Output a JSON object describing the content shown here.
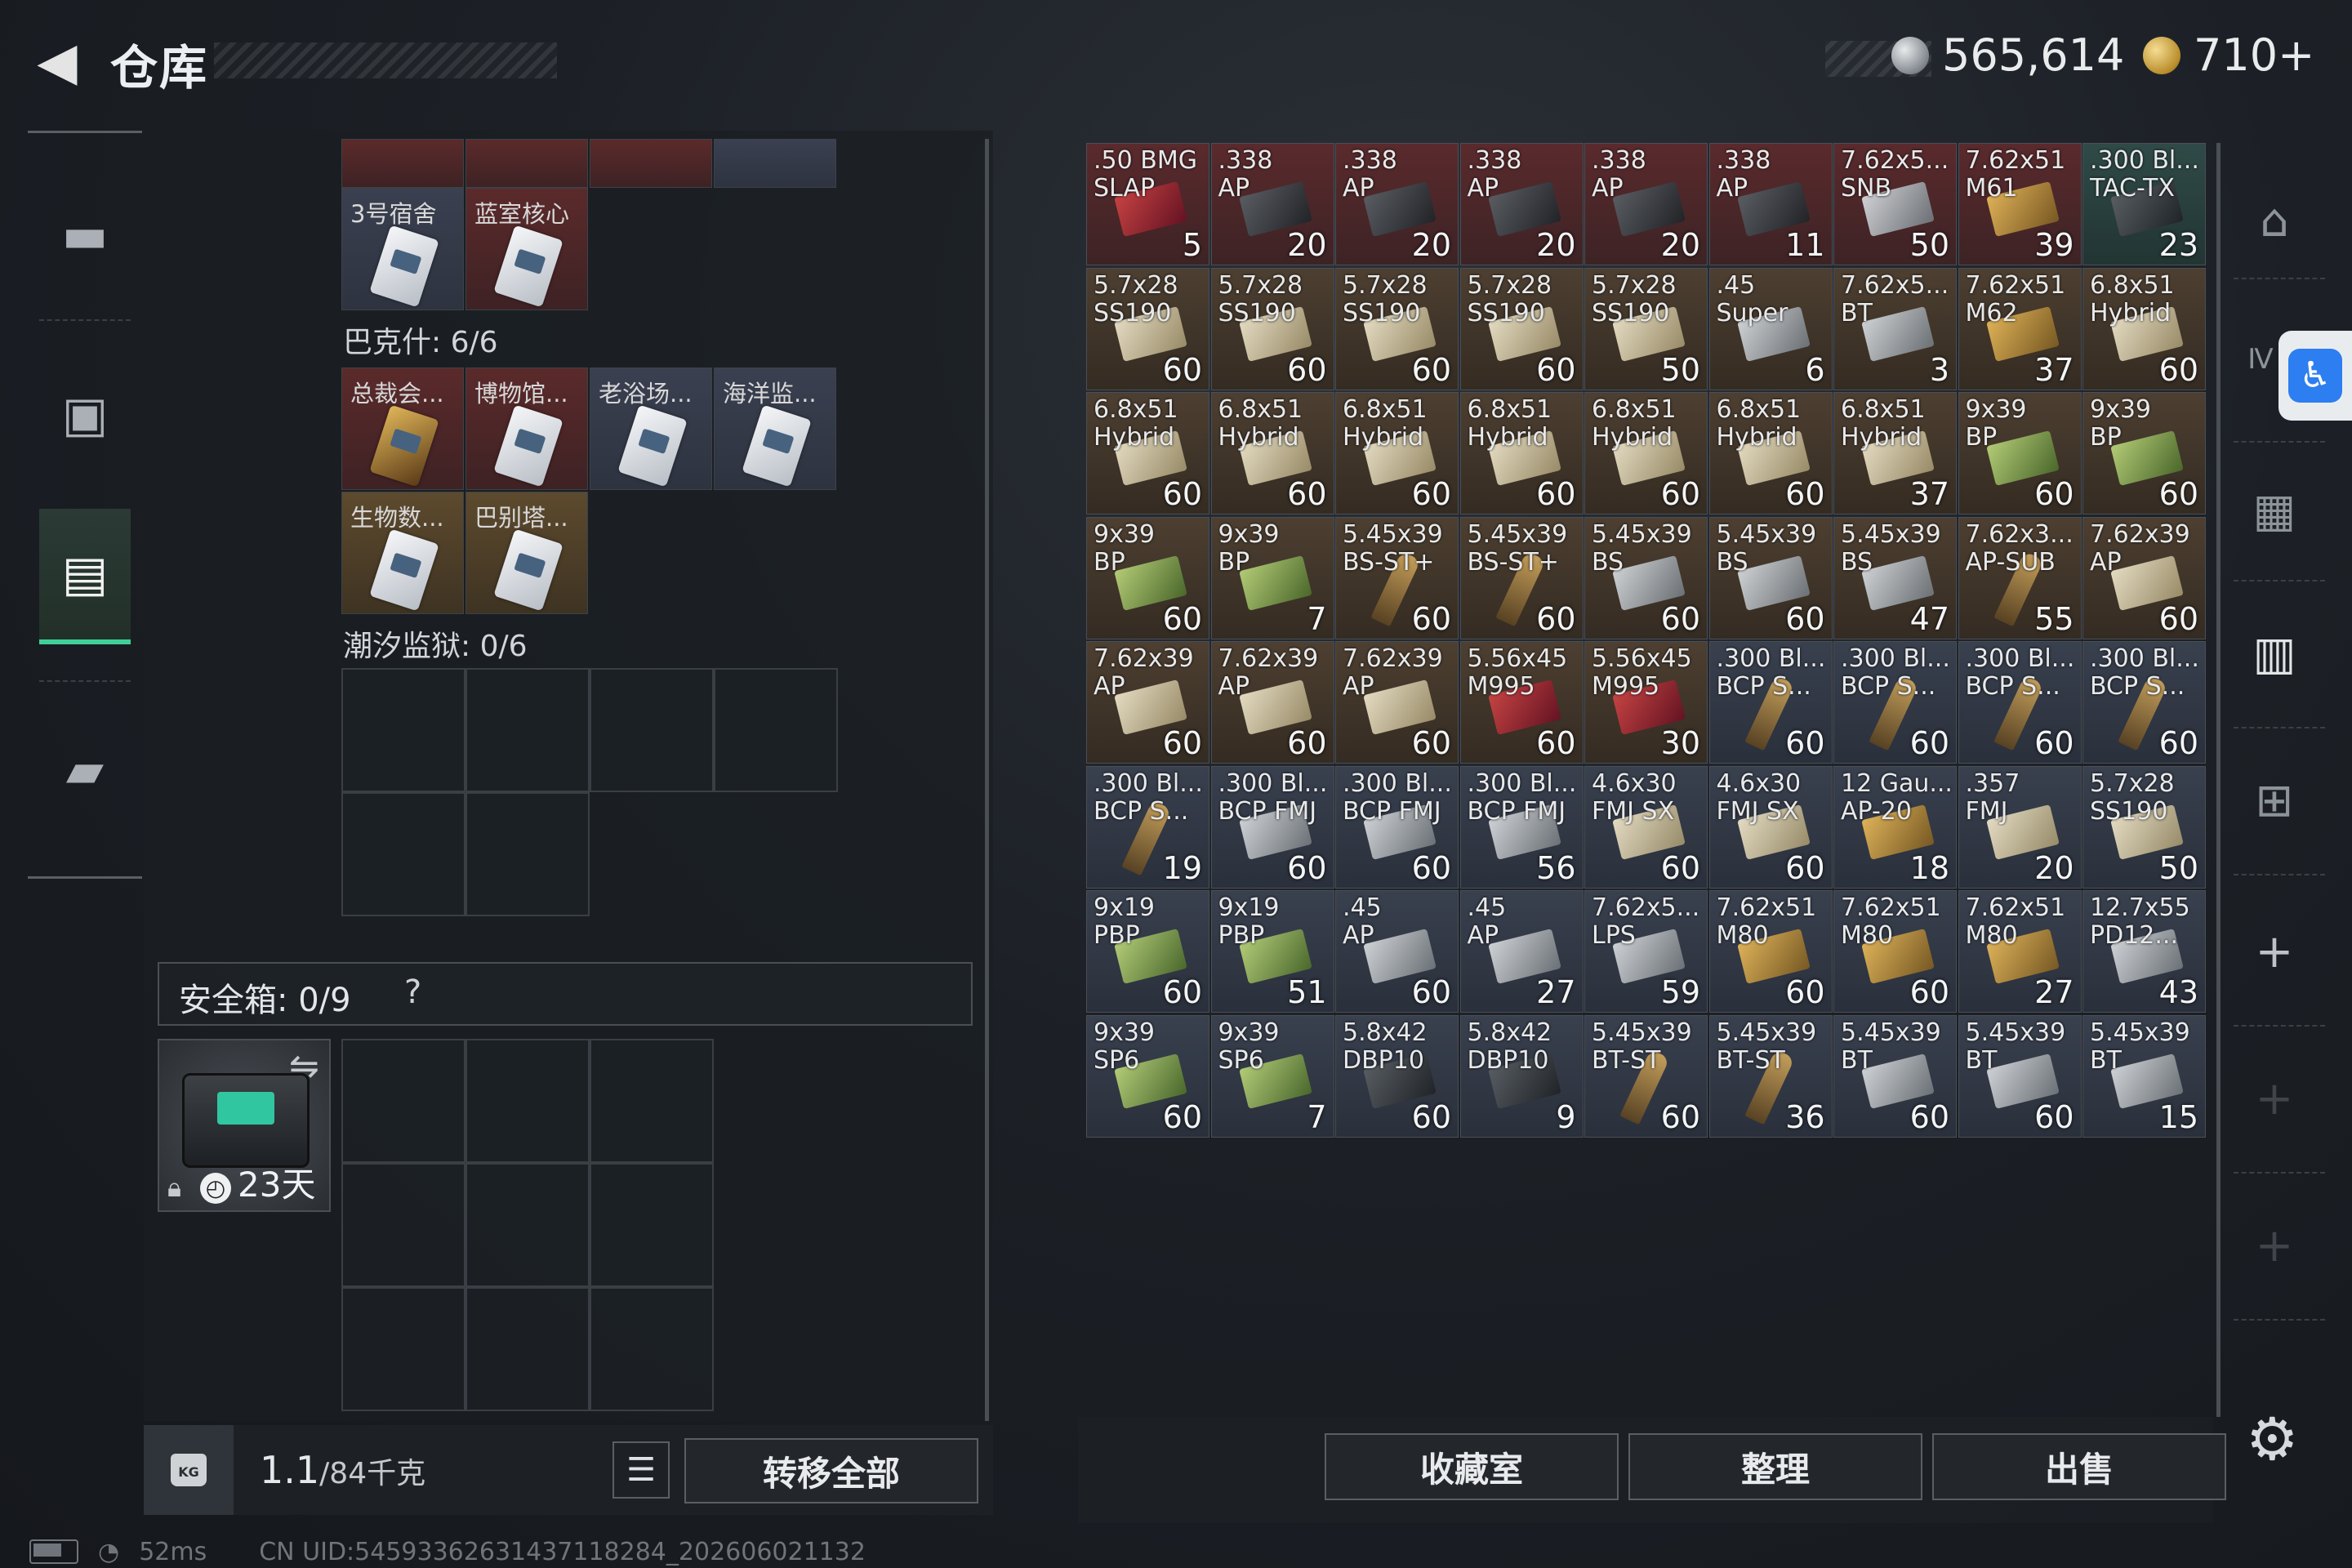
{
  "header": {
    "back_glyph": "◀",
    "title": "仓库",
    "silver_amount": "565,614",
    "gold_amount": "710+"
  },
  "sidebar": {
    "items": [
      {
        "name": "weapon",
        "icon": "pistol-icon"
      },
      {
        "name": "backpack",
        "icon": "backpack-icon"
      },
      {
        "name": "storage",
        "icon": "container-icon",
        "active": true
      },
      {
        "name": "case",
        "icon": "briefcase-icon"
      }
    ]
  },
  "keycards": {
    "top_row": [
      {
        "label": "",
        "color": "red"
      },
      {
        "label": "",
        "color": "red"
      },
      {
        "label": "",
        "color": "red"
      },
      {
        "label": "",
        "color": "blue"
      }
    ],
    "row2": [
      {
        "label": "3号宿舍",
        "color": "blue"
      },
      {
        "label": "蓝室核心",
        "color": "red"
      }
    ],
    "group1_label": "巴克什: 6/6",
    "group1_row1": [
      {
        "label": "总裁会...",
        "color": "red",
        "art": "gold"
      },
      {
        "label": "博物馆...",
        "color": "red"
      },
      {
        "label": "老浴场...",
        "color": "blue"
      },
      {
        "label": "海洋监...",
        "color": "blue"
      }
    ],
    "group1_row2": [
      {
        "label": "生物数...",
        "color": "gold"
      },
      {
        "label": "巴别塔...",
        "color": "gold"
      }
    ],
    "group2_label": "潮汐监狱: 0/6"
  },
  "safe": {
    "title": "安全箱:  0/9",
    "help": "?",
    "days": "23天"
  },
  "bottom_left": {
    "weight_icon_text": "KG",
    "weight": "1.1",
    "capacity": "/84",
    "unit": "千克",
    "transfer_all": "转移全部"
  },
  "ammo": [
    [
      {
        "name": ".50 BMG\nSLAP",
        "count": "5",
        "color": "red",
        "art": "red"
      },
      {
        "name": ".338\nAP",
        "count": "20",
        "color": "red",
        "art": "dark"
      },
      {
        "name": ".338\nAP",
        "count": "20",
        "color": "red",
        "art": "dark"
      },
      {
        "name": ".338\nAP",
        "count": "20",
        "color": "red",
        "art": "dark"
      },
      {
        "name": ".338\nAP",
        "count": "20",
        "color": "red",
        "art": "dark"
      },
      {
        "name": ".338\nAP",
        "count": "11",
        "color": "red",
        "art": "dark"
      },
      {
        "name": "7.62x5...\nSNB",
        "count": "50",
        "color": "red",
        "art": "gray"
      },
      {
        "name": "7.62x51\nM61",
        "count": "39",
        "color": "red",
        "art": "gold"
      },
      {
        "name": ".300 Bl...\nTAC-TX",
        "count": "23",
        "color": "teal",
        "art": "dark"
      }
    ],
    [
      {
        "name": "5.7x28\nSS190",
        "count": "60",
        "color": "brown",
        "art": "box"
      },
      {
        "name": "5.7x28\nSS190",
        "count": "60",
        "color": "brown",
        "art": "box"
      },
      {
        "name": "5.7x28\nSS190",
        "count": "60",
        "color": "brown",
        "art": "box"
      },
      {
        "name": "5.7x28\nSS190",
        "count": "60",
        "color": "brown",
        "art": "box"
      },
      {
        "name": "5.7x28\nSS190",
        "count": "50",
        "color": "brown",
        "art": "box"
      },
      {
        "name": ".45\nSuper",
        "count": "6",
        "color": "brown",
        "art": "gray"
      },
      {
        "name": "7.62x5...\nBT",
        "count": "3",
        "color": "brown",
        "art": "gray"
      },
      {
        "name": "7.62x51\nM62",
        "count": "37",
        "color": "brown",
        "art": "gold"
      },
      {
        "name": "6.8x51\nHybrid",
        "count": "60",
        "color": "brown",
        "art": "box"
      }
    ],
    [
      {
        "name": "6.8x51\nHybrid",
        "count": "60",
        "color": "brown",
        "art": "box"
      },
      {
        "name": "6.8x51\nHybrid",
        "count": "60",
        "color": "brown",
        "art": "box"
      },
      {
        "name": "6.8x51\nHybrid",
        "count": "60",
        "color": "brown",
        "art": "box"
      },
      {
        "name": "6.8x51\nHybrid",
        "count": "60",
        "color": "brown",
        "art": "box"
      },
      {
        "name": "6.8x51\nHybrid",
        "count": "60",
        "color": "brown",
        "art": "box"
      },
      {
        "name": "6.8x51\nHybrid",
        "count": "60",
        "color": "brown",
        "art": "box"
      },
      {
        "name": "6.8x51\nHybrid",
        "count": "37",
        "color": "brown",
        "art": "box"
      },
      {
        "name": "9x39\nBP",
        "count": "60",
        "color": "brown",
        "art": "green"
      },
      {
        "name": "9x39\nBP",
        "count": "60",
        "color": "brown",
        "art": "green"
      }
    ],
    [
      {
        "name": "9x39\nBP",
        "count": "60",
        "color": "brown",
        "art": "green"
      },
      {
        "name": "9x39\nBP",
        "count": "7",
        "color": "brown",
        "art": "green"
      },
      {
        "name": "5.45x39\nBS-ST+",
        "count": "60",
        "color": "brown",
        "art": "bullet"
      },
      {
        "name": "5.45x39\nBS-ST+",
        "count": "60",
        "color": "brown",
        "art": "bullet"
      },
      {
        "name": "5.45x39\nBS",
        "count": "60",
        "color": "brown",
        "art": "gray"
      },
      {
        "name": "5.45x39\nBS",
        "count": "60",
        "color": "brown",
        "art": "gray"
      },
      {
        "name": "5.45x39\nBS",
        "count": "47",
        "color": "brown",
        "art": "gray"
      },
      {
        "name": "7.62x3...\nAP-SUB",
        "count": "55",
        "color": "brown",
        "art": "bullet"
      },
      {
        "name": "7.62x39\nAP",
        "count": "60",
        "color": "brown",
        "art": "box"
      }
    ],
    [
      {
        "name": "7.62x39\nAP",
        "count": "60",
        "color": "brown",
        "art": "box"
      },
      {
        "name": "7.62x39\nAP",
        "count": "60",
        "color": "brown",
        "art": "box"
      },
      {
        "name": "7.62x39\nAP",
        "count": "60",
        "color": "brown",
        "art": "box"
      },
      {
        "name": "5.56x45\nM995",
        "count": "60",
        "color": "brown",
        "art": "red"
      },
      {
        "name": "5.56x45\nM995",
        "count": "30",
        "color": "brown",
        "art": "red"
      },
      {
        "name": ".300 Bl...\nBCP S...",
        "count": "60",
        "color": "blue",
        "art": "bullet"
      },
      {
        "name": ".300 Bl...\nBCP S...",
        "count": "60",
        "color": "blue",
        "art": "bullet"
      },
      {
        "name": ".300 Bl...\nBCP S...",
        "count": "60",
        "color": "blue",
        "art": "bullet"
      },
      {
        "name": ".300 Bl...\nBCP S...",
        "count": "60",
        "color": "blue",
        "art": "bullet"
      }
    ],
    [
      {
        "name": ".300 Bl...\nBCP S...",
        "count": "19",
        "color": "blue",
        "art": "bullet"
      },
      {
        "name": ".300 Bl...\nBCP FMJ",
        "count": "60",
        "color": "blue",
        "art": "gray"
      },
      {
        "name": ".300 Bl...\nBCP FMJ",
        "count": "60",
        "color": "blue",
        "art": "gray"
      },
      {
        "name": ".300 Bl...\nBCP FMJ",
        "count": "56",
        "color": "blue",
        "art": "gray"
      },
      {
        "name": "4.6x30\nFMJ SX",
        "count": "60",
        "color": "blue",
        "art": "box"
      },
      {
        "name": "4.6x30\nFMJ SX",
        "count": "60",
        "color": "blue",
        "art": "box"
      },
      {
        "name": "12 Gau...\nAP-20",
        "count": "18",
        "color": "blue",
        "art": "gold"
      },
      {
        "name": ".357\nFMJ",
        "count": "20",
        "color": "blue",
        "art": "box"
      },
      {
        "name": "5.7x28\nSS190",
        "count": "50",
        "color": "blue",
        "art": "box"
      }
    ],
    [
      {
        "name": "9x19\nPBP",
        "count": "60",
        "color": "blue",
        "art": "green"
      },
      {
        "name": "9x19\nPBP",
        "count": "51",
        "color": "blue",
        "art": "green"
      },
      {
        "name": ".45\nAP",
        "count": "60",
        "color": "blue",
        "art": "gray"
      },
      {
        "name": ".45\nAP",
        "count": "27",
        "color": "blue",
        "art": "gray"
      },
      {
        "name": "7.62x5...\nLPS",
        "count": "59",
        "color": "blue",
        "art": "gray"
      },
      {
        "name": "7.62x51\nM80",
        "count": "60",
        "color": "blue",
        "art": "gold"
      },
      {
        "name": "7.62x51\nM80",
        "count": "60",
        "color": "blue",
        "art": "gold"
      },
      {
        "name": "7.62x51\nM80",
        "count": "27",
        "color": "blue",
        "art": "gold"
      },
      {
        "name": "12.7x55\nPD12...",
        "count": "43",
        "color": "blue",
        "art": "gray"
      }
    ],
    [
      {
        "name": "9x39\nSP6",
        "count": "60",
        "color": "blue",
        "art": "green"
      },
      {
        "name": "9x39\nSP6",
        "count": "7",
        "color": "blue",
        "art": "green"
      },
      {
        "name": "5.8x42\nDBP10",
        "count": "60",
        "color": "blue",
        "art": "dark"
      },
      {
        "name": "5.8x42\nDBP10",
        "count": "9",
        "color": "blue",
        "art": "dark"
      },
      {
        "name": "5.45x39\nBT-ST",
        "count": "60",
        "color": "blue",
        "art": "bullet"
      },
      {
        "name": "5.45x39\nBT-ST",
        "count": "36",
        "color": "blue",
        "art": "bullet"
      },
      {
        "name": "5.45x39\nBT",
        "count": "60",
        "color": "blue",
        "art": "gray"
      },
      {
        "name": "5.45x39\nBT",
        "count": "60",
        "color": "blue",
        "art": "gray"
      },
      {
        "name": "5.45x39\nBT",
        "count": "15",
        "color": "blue",
        "art": "gray"
      }
    ]
  ],
  "actions": {
    "collection": "收藏室",
    "organize": "整理",
    "sell": "出售"
  },
  "right_sidebar": {
    "items": [
      "shelter-icon",
      "iv-icon",
      "camera-icon",
      "iv-storage-icon",
      "iv-add-icon",
      "plus-icon",
      "plus-icon",
      "plus-icon"
    ]
  },
  "status": {
    "ping": "52ms",
    "uid": "CN UID:54593362631437118284_202606021132"
  },
  "colors": {
    "accent_green": "#3fd09a",
    "accessibility_blue": "#2d7ef0"
  }
}
